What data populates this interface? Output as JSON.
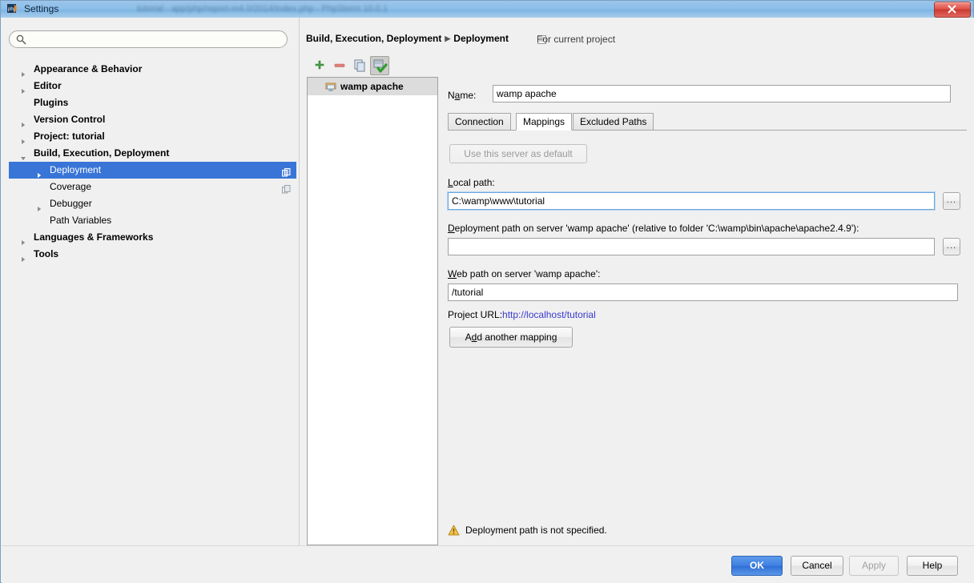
{
  "window": {
    "title": "Settings",
    "app_icon": "phpstorm-icon",
    "close_label": "×",
    "background_blur_text": "tutorial - app/php/report-m4.0/2014/index.php - PhpStorm 10.0.1"
  },
  "search": {
    "value": "",
    "placeholder": "",
    "icon": "search-icon"
  },
  "sidebar": {
    "items": [
      {
        "label": "Appearance & Behavior",
        "level": 0,
        "arrow": "collapsed",
        "selected": false,
        "badge": false
      },
      {
        "label": "Editor",
        "level": 0,
        "arrow": "collapsed",
        "selected": false,
        "badge": false
      },
      {
        "label": "Plugins",
        "level": 0,
        "arrow": "none",
        "selected": false,
        "badge": false
      },
      {
        "label": "Version Control",
        "level": 0,
        "arrow": "collapsed",
        "selected": false,
        "badge": false
      },
      {
        "label": "Project: tutorial",
        "level": 0,
        "arrow": "collapsed",
        "selected": false,
        "badge": false
      },
      {
        "label": "Build, Execution, Deployment",
        "level": 0,
        "arrow": "expanded",
        "selected": false,
        "badge": false
      },
      {
        "label": "Deployment",
        "level": 1,
        "arrow": "collapsed",
        "selected": true,
        "badge": true
      },
      {
        "label": "Coverage",
        "level": 1,
        "arrow": "none",
        "selected": false,
        "badge": true
      },
      {
        "label": "Debugger",
        "level": 1,
        "arrow": "collapsed",
        "selected": false,
        "badge": false
      },
      {
        "label": "Path Variables",
        "level": 1,
        "arrow": "none",
        "selected": false,
        "badge": false
      },
      {
        "label": "Languages & Frameworks",
        "level": 0,
        "arrow": "collapsed",
        "selected": false,
        "badge": false
      },
      {
        "label": "Tools",
        "level": 0,
        "arrow": "collapsed",
        "selected": false,
        "badge": false
      }
    ]
  },
  "breadcrumb": {
    "root": "Build, Execution, Deployment",
    "separator": "▶",
    "leaf": "Deployment",
    "scope_note": "For current project",
    "scope_icon": "project-scope-icon"
  },
  "server_toolbar": {
    "add_label": "+",
    "remove_label": "−",
    "copy_label": "copy-icon",
    "default_label": "set-default-icon"
  },
  "server_list": {
    "items": [
      {
        "label": "wamp apache",
        "icon": "server-icon",
        "selected": true
      }
    ]
  },
  "form": {
    "name_label": "Name:",
    "name_mnemonic": "a",
    "name_value": "wamp apache",
    "tabs": [
      {
        "label": "Connection",
        "active": false
      },
      {
        "label": "Mappings",
        "active": true
      },
      {
        "label": "Excluded Paths",
        "active": false
      }
    ],
    "use_default_button": "Use this server as default",
    "use_default_disabled": true,
    "local_path_label": "Local path:",
    "local_path_mnemonic": "L",
    "local_path_value": "C:\\wamp\\www\\tutorial",
    "local_path_focused": true,
    "deploy_path_label": "Deployment path on server 'wamp apache' (relative to folder 'C:\\wamp\\bin\\apache\\apache2.4.9'):",
    "deploy_path_mnemonic": "D",
    "deploy_path_value": "",
    "web_path_label": "Web path on server 'wamp apache':",
    "web_path_mnemonic": "W",
    "web_path_value": "/tutorial",
    "browse_label": "...",
    "project_url_label": "Project URL:",
    "project_url_value": "http://localhost/tutorial",
    "add_mapping_button": "Add another mapping",
    "add_mapping_mnemonic": "d"
  },
  "warning": {
    "icon": "warning-triangle-icon",
    "text": "Deployment path is not specified."
  },
  "footer": {
    "ok": "OK",
    "cancel": "Cancel",
    "apply": "Apply",
    "apply_disabled": true,
    "help": "Help"
  },
  "colors": {
    "selection_blue": "#3875d7",
    "link_blue": "#3a3ad0",
    "default_button_blue": "#3f7fe0",
    "warning_amber": "#e8a33d",
    "add_green": "#47a047",
    "remove_red": "#d46c6c"
  }
}
